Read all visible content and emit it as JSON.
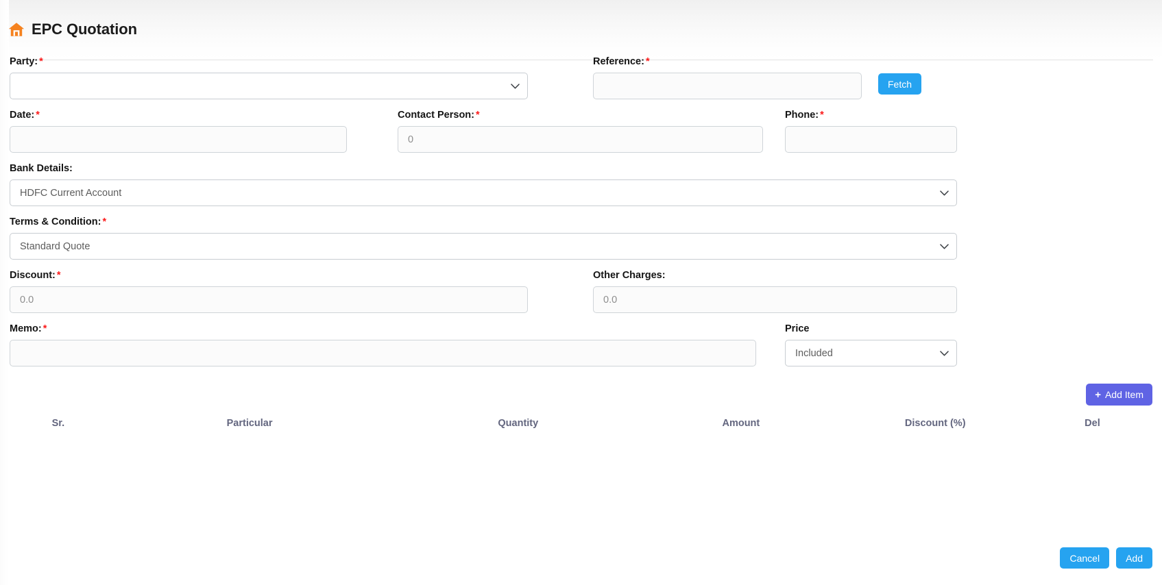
{
  "header": {
    "icon": "home-icon",
    "icon_color": "#f5821f",
    "title": "EPC Quotation"
  },
  "form": {
    "party": {
      "label": "Party:",
      "required": true,
      "value": "",
      "options": [
        ""
      ]
    },
    "reference": {
      "label": "Reference:",
      "required": true,
      "value": "",
      "placeholder": ""
    },
    "fetch_button": {
      "label": "Fetch",
      "color": "#26a3f0"
    },
    "date": {
      "label": "Date:",
      "required": true,
      "value": "",
      "placeholder": ""
    },
    "contact_person": {
      "label": "Contact Person:",
      "required": true,
      "value": "",
      "placeholder": "0"
    },
    "phone": {
      "label": "Phone:",
      "required": true,
      "value": "",
      "placeholder": ""
    },
    "bank_details": {
      "label": "Bank Details:",
      "required": false,
      "value": "HDFC Current Account",
      "options": [
        "HDFC Current Account"
      ]
    },
    "terms_condition": {
      "label": "Terms & Condition:",
      "required": true,
      "value": "Standard Quote",
      "options": [
        "Standard Quote"
      ]
    },
    "discount": {
      "label": "Discount:",
      "required": true,
      "value": "",
      "placeholder": "0.0"
    },
    "other_charges": {
      "label": "Other Charges:",
      "required": false,
      "value": "",
      "placeholder": "0.0"
    },
    "memo": {
      "label": "Memo:",
      "required": true,
      "value": "",
      "placeholder": ""
    },
    "price": {
      "label": "Price",
      "required": false,
      "value": "Included",
      "options": [
        "Included"
      ]
    }
  },
  "items": {
    "add_item_button": {
      "label": "Add Item",
      "icon": "plus-icon",
      "color": "#5f63e4"
    },
    "columns": [
      "Sr.",
      "Particular",
      "Quantity",
      "Amount",
      "Discount (%)",
      "Del"
    ],
    "rows": []
  },
  "footer": {
    "cancel_button": {
      "label": "Cancel",
      "color": "#26a3f0"
    },
    "add_button": {
      "label": "Add",
      "color": "#26a3f0"
    }
  },
  "required_marker": "*"
}
